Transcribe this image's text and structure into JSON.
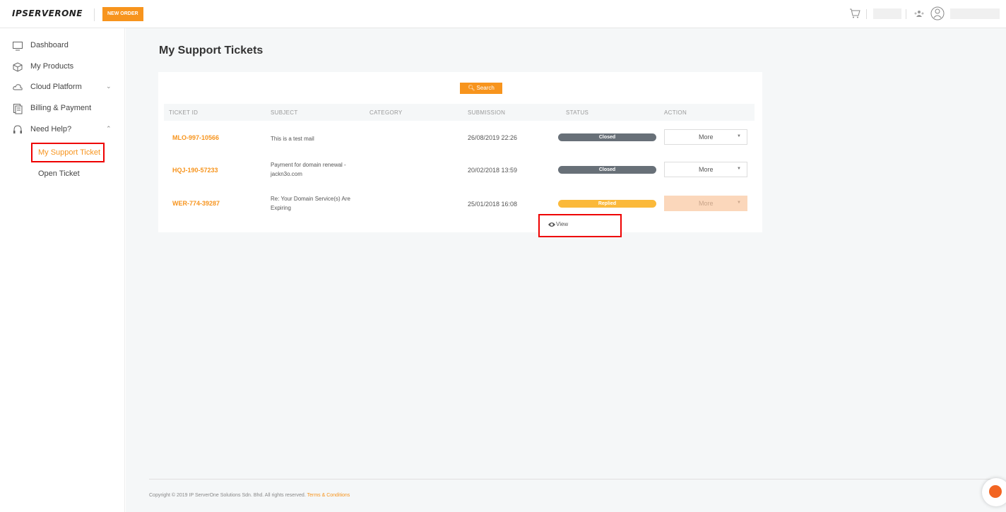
{
  "header": {
    "logo_text": "IPSERVERONE",
    "new_order_label": "NEW ORDER"
  },
  "sidebar": {
    "items": [
      {
        "label": "Dashboard",
        "icon": "monitor-icon"
      },
      {
        "label": "My Products",
        "icon": "box-icon"
      },
      {
        "label": "Cloud Platform",
        "icon": "cloud-icon",
        "chevron": "⌄"
      },
      {
        "label": "Billing & Payment",
        "icon": "billing-icon"
      },
      {
        "label": "Need Help?",
        "icon": "headset-icon",
        "chevron": "⌃"
      }
    ],
    "sub_items": [
      {
        "label": "My Support Ticket",
        "active": true
      },
      {
        "label": "Open Ticket",
        "active": false
      }
    ]
  },
  "main": {
    "title": "My Support Tickets",
    "search_label": "Search",
    "columns": [
      "TICKET ID",
      "SUBJECT",
      "CATEGORY",
      "SUBMISSION",
      "STATUS",
      "ACTION"
    ],
    "rows": [
      {
        "ticket_id": "MLO-997-10566",
        "subject": "This is a test mail",
        "category": "",
        "submission": "26/08/2019 22:26",
        "status": "Closed",
        "action": "More"
      },
      {
        "ticket_id": "HQJ-190-57233",
        "subject": "Payment for domain renewal - jackn3o.com",
        "category": "",
        "submission": "20/02/2018 13:59",
        "status": "Closed",
        "action": "More"
      },
      {
        "ticket_id": "WER-774-39287",
        "subject": "Re: Your Domain Service(s) Are Expiring",
        "category": "",
        "submission": "25/01/2018 16:08",
        "status": "Replied",
        "action": "More"
      }
    ],
    "dropdown_view_label": "View"
  },
  "footer": {
    "copyright": "Copyright © 2019 IP ServerOne Solutions Sdn. Bhd. All rights reserved.",
    "terms_label": "Terms & Conditions"
  },
  "colors": {
    "accent": "#f7941d",
    "closed": "#687078",
    "replied": "#fbb93a",
    "highlight": "#ee0000"
  }
}
